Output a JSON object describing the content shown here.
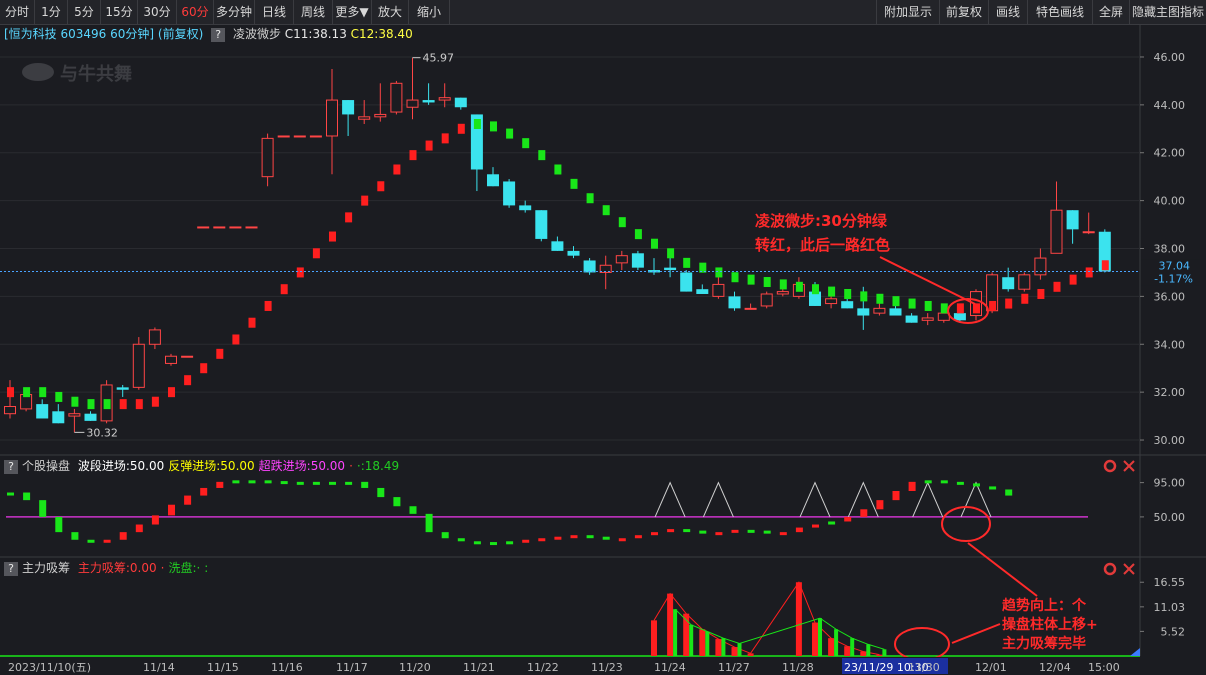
{
  "toolbar": {
    "left": [
      {
        "label": "分时",
        "active": false
      },
      {
        "label": "1分",
        "active": false
      },
      {
        "label": "5分",
        "active": false
      },
      {
        "label": "15分",
        "active": false
      },
      {
        "label": "30分",
        "active": false
      },
      {
        "label": "60分",
        "active": true
      },
      {
        "label": "多分钟",
        "active": false
      },
      {
        "label": "日线",
        "active": false
      },
      {
        "label": "周线",
        "active": false
      },
      {
        "label": "更多▼",
        "active": false
      },
      {
        "label": "放大",
        "active": false
      },
      {
        "label": "缩小",
        "active": false
      }
    ],
    "right": [
      "附加显示",
      "前复权",
      "画线",
      "特色画线",
      "全屏",
      "隐藏主图指标"
    ]
  },
  "info": {
    "stock": "[恒为科技 603496 60分钟]",
    "adjust": "(前复权)",
    "indicator": "凌波微步",
    "c1": "C11:38.13",
    "c2": "C12:38.40",
    "help": "?"
  },
  "watermark": "与牛共舞",
  "main_axis": {
    "ticks": [
      "46.00",
      "44.00",
      "42.00",
      "40.00",
      "38.00",
      "36.00",
      "34.00",
      "32.00",
      "30.00"
    ]
  },
  "price_marker": {
    "price": "37.04",
    "pct": "-1.17%"
  },
  "annotations": {
    "high_label": "45.97",
    "low_label": "30.32",
    "note1_line1": "凌波微步:30分钟绿",
    "note1_line2": "转红，此后一路红色",
    "note2_line1": "趋势向上：个",
    "note2_line2": "操盘柱体上移+",
    "note2_line3": "主力吸筹完毕"
  },
  "panel2": {
    "title": "个股操盘",
    "params": [
      {
        "text": "波段进场:50.00",
        "color": "#ffffff"
      },
      {
        "text": "反弹进场:50.00",
        "color": "#ffff00"
      },
      {
        "text": "超跌进场:50.00",
        "color": "#ff44ff"
      },
      {
        "text": "·",
        "color": "#ff3b3b"
      },
      {
        "text": "·:18.49",
        "color": "#22cc22"
      }
    ],
    "ticks": [
      "95.00",
      "50.00"
    ]
  },
  "panel3": {
    "title": "主力吸筹",
    "params": [
      {
        "text": "主力吸筹:0.00",
        "color": "#ff3b3b"
      },
      {
        "text": "·",
        "color": "#ff3b3b"
      },
      {
        "text": "洗盘:·",
        "color": "#22cc22"
      },
      {
        "text": ":",
        "color": "#22cc22"
      }
    ],
    "ticks": [
      "16.55",
      "11.03",
      "5.52"
    ]
  },
  "xaxis": {
    "labels": [
      "2023/11/10(五)",
      "11/14",
      "11/15",
      "11/16",
      "11/17",
      "11/20",
      "11/21",
      "11/22",
      "11/23",
      "11/24",
      "11/27",
      "11/28",
      "23/11/29 10:30",
      "11/30",
      "12/01",
      "12/04",
      "15:00"
    ]
  },
  "chart_data": {
    "type": "candlestick",
    "period": "60分钟",
    "ylim": [
      29.5,
      46.5
    ],
    "candles": [
      {
        "o": 31.1,
        "h": 32.5,
        "l": 30.9,
        "c": 31.4
      },
      {
        "o": 31.3,
        "h": 32.0,
        "l": 31.2,
        "c": 31.9
      },
      {
        "o": 31.5,
        "h": 31.7,
        "l": 30.9,
        "c": 30.9
      },
      {
        "o": 31.2,
        "h": 31.5,
        "l": 30.7,
        "c": 30.7
      },
      {
        "o": 31.0,
        "h": 31.3,
        "l": 30.32,
        "c": 31.1
      },
      {
        "o": 31.1,
        "h": 31.2,
        "l": 30.8,
        "c": 30.8
      },
      {
        "o": 30.8,
        "h": 32.5,
        "l": 30.7,
        "c": 32.3
      },
      {
        "o": 32.2,
        "h": 32.3,
        "l": 31.8,
        "c": 32.1
      },
      {
        "o": 32.2,
        "h": 34.3,
        "l": 32.1,
        "c": 34.0
      },
      {
        "o": 34.0,
        "h": 34.7,
        "l": 33.8,
        "c": 34.6
      },
      {
        "o": 33.2,
        "h": 33.6,
        "l": 33.1,
        "c": 33.5
      },
      {
        "o": 33.5,
        "h": 33.5,
        "l": 33.5,
        "c": 33.5
      },
      {
        "o": 38.9,
        "h": 38.9,
        "l": 38.9,
        "c": 38.9
      },
      {
        "o": 38.9,
        "h": 38.9,
        "l": 38.9,
        "c": 38.9
      },
      {
        "o": 38.9,
        "h": 38.9,
        "l": 38.9,
        "c": 38.9
      },
      {
        "o": 38.9,
        "h": 38.9,
        "l": 38.9,
        "c": 38.9
      },
      {
        "o": 41.0,
        "h": 42.8,
        "l": 40.6,
        "c": 42.6
      },
      {
        "o": 42.7,
        "h": 42.7,
        "l": 42.7,
        "c": 42.7
      },
      {
        "o": 42.7,
        "h": 42.7,
        "l": 42.7,
        "c": 42.7
      },
      {
        "o": 42.7,
        "h": 42.7,
        "l": 42.7,
        "c": 42.7
      },
      {
        "o": 42.7,
        "h": 45.5,
        "l": 41.1,
        "c": 44.2
      },
      {
        "o": 44.2,
        "h": 44.2,
        "l": 42.7,
        "c": 43.6
      },
      {
        "o": 43.4,
        "h": 44.2,
        "l": 43.2,
        "c": 43.5
      },
      {
        "o": 43.5,
        "h": 44.9,
        "l": 43.3,
        "c": 43.6
      },
      {
        "o": 43.7,
        "h": 45.0,
        "l": 43.6,
        "c": 44.9
      },
      {
        "o": 43.9,
        "h": 45.97,
        "l": 43.4,
        "c": 44.2
      },
      {
        "o": 44.2,
        "h": 44.9,
        "l": 44.0,
        "c": 44.1
      },
      {
        "o": 44.2,
        "h": 44.9,
        "l": 43.9,
        "c": 44.3
      },
      {
        "o": 44.3,
        "h": 44.3,
        "l": 43.8,
        "c": 43.9
      },
      {
        "o": 43.6,
        "h": 43.6,
        "l": 40.4,
        "c": 41.3
      },
      {
        "o": 41.1,
        "h": 41.4,
        "l": 40.6,
        "c": 40.6
      },
      {
        "o": 40.8,
        "h": 40.9,
        "l": 39.7,
        "c": 39.8
      },
      {
        "o": 39.8,
        "h": 40.0,
        "l": 39.5,
        "c": 39.6
      },
      {
        "o": 39.6,
        "h": 39.6,
        "l": 38.3,
        "c": 38.4
      },
      {
        "o": 38.3,
        "h": 38.5,
        "l": 37.9,
        "c": 37.9
      },
      {
        "o": 37.9,
        "h": 38.1,
        "l": 37.6,
        "c": 37.7
      },
      {
        "o": 37.5,
        "h": 37.6,
        "l": 36.9,
        "c": 37.0
      },
      {
        "o": 37.0,
        "h": 37.7,
        "l": 36.3,
        "c": 37.3
      },
      {
        "o": 37.4,
        "h": 37.9,
        "l": 37.1,
        "c": 37.7
      },
      {
        "o": 37.8,
        "h": 37.9,
        "l": 37.1,
        "c": 37.2
      },
      {
        "o": 37.1,
        "h": 37.6,
        "l": 36.9,
        "c": 37.0
      },
      {
        "o": 37.2,
        "h": 37.7,
        "l": 36.8,
        "c": 37.1
      },
      {
        "o": 37.0,
        "h": 37.1,
        "l": 36.2,
        "c": 36.2
      },
      {
        "o": 36.3,
        "h": 36.5,
        "l": 36.1,
        "c": 36.1
      },
      {
        "o": 36.0,
        "h": 36.8,
        "l": 35.9,
        "c": 36.5
      },
      {
        "o": 36.0,
        "h": 36.2,
        "l": 35.4,
        "c": 35.5
      },
      {
        "o": 35.5,
        "h": 35.7,
        "l": 35.5,
        "c": 35.5
      },
      {
        "o": 35.6,
        "h": 36.2,
        "l": 35.5,
        "c": 36.1
      },
      {
        "o": 36.1,
        "h": 36.5,
        "l": 36.0,
        "c": 36.2
      },
      {
        "o": 36.0,
        "h": 36.8,
        "l": 35.9,
        "c": 36.5
      },
      {
        "o": 36.2,
        "h": 36.6,
        "l": 35.6,
        "c": 35.6
      },
      {
        "o": 35.7,
        "h": 36.0,
        "l": 35.5,
        "c": 35.9
      },
      {
        "o": 35.8,
        "h": 36.0,
        "l": 35.5,
        "c": 35.5
      },
      {
        "o": 35.5,
        "h": 36.4,
        "l": 34.6,
        "c": 35.2
      },
      {
        "o": 35.3,
        "h": 35.9,
        "l": 35.2,
        "c": 35.5
      },
      {
        "o": 35.5,
        "h": 35.6,
        "l": 35.2,
        "c": 35.2
      },
      {
        "o": 35.2,
        "h": 35.3,
        "l": 34.9,
        "c": 34.9
      },
      {
        "o": 35.0,
        "h": 35.3,
        "l": 34.8,
        "c": 35.1
      },
      {
        "o": 35.0,
        "h": 35.4,
        "l": 34.9,
        "c": 35.3
      },
      {
        "o": 35.3,
        "h": 35.7,
        "l": 34.9,
        "c": 35.0
      },
      {
        "o": 35.2,
        "h": 36.3,
        "l": 35.0,
        "c": 36.2
      },
      {
        "o": 35.4,
        "h": 37.0,
        "l": 35.3,
        "c": 36.9
      },
      {
        "o": 36.8,
        "h": 37.2,
        "l": 36.2,
        "c": 36.3
      },
      {
        "o": 36.3,
        "h": 37.0,
        "l": 36.2,
        "c": 36.9
      },
      {
        "o": 36.9,
        "h": 38.0,
        "l": 36.7,
        "c": 37.6
      },
      {
        "o": 37.8,
        "h": 40.8,
        "l": 37.8,
        "c": 39.6
      },
      {
        "o": 39.6,
        "h": 39.6,
        "l": 38.2,
        "c": 38.8
      },
      {
        "o": 38.7,
        "h": 39.5,
        "l": 38.6,
        "c": 38.7
      },
      {
        "o": 38.7,
        "h": 38.8,
        "l": 37.0,
        "c": 37.04
      }
    ],
    "ling_bo_wei_bu": [
      {
        "v": 32.0,
        "color": "red"
      },
      {
        "v": 32.0,
        "color": "green"
      },
      {
        "v": 32.0,
        "color": "green"
      },
      {
        "v": 31.8,
        "color": "green"
      },
      {
        "v": 31.6,
        "color": "green"
      },
      {
        "v": 31.5,
        "color": "green"
      },
      {
        "v": 31.5,
        "color": "green"
      },
      {
        "v": 31.5,
        "color": "red"
      },
      {
        "v": 31.5,
        "color": "red"
      },
      {
        "v": 31.6,
        "color": "red"
      },
      {
        "v": 32.0,
        "color": "red"
      },
      {
        "v": 32.5,
        "color": "red"
      },
      {
        "v": 33.0,
        "color": "red"
      },
      {
        "v": 33.6,
        "color": "red"
      },
      {
        "v": 34.2,
        "color": "red"
      },
      {
        "v": 34.9,
        "color": "red"
      },
      {
        "v": 35.6,
        "color": "red"
      },
      {
        "v": 36.3,
        "color": "red"
      },
      {
        "v": 37.0,
        "color": "red"
      },
      {
        "v": 37.8,
        "color": "red"
      },
      {
        "v": 38.5,
        "color": "red"
      },
      {
        "v": 39.3,
        "color": "red"
      },
      {
        "v": 40.0,
        "color": "red"
      },
      {
        "v": 40.6,
        "color": "red"
      },
      {
        "v": 41.3,
        "color": "red"
      },
      {
        "v": 41.9,
        "color": "red"
      },
      {
        "v": 42.3,
        "color": "red"
      },
      {
        "v": 42.6,
        "color": "red"
      },
      {
        "v": 43.0,
        "color": "red"
      },
      {
        "v": 43.2,
        "color": "green"
      },
      {
        "v": 43.1,
        "color": "green"
      },
      {
        "v": 42.8,
        "color": "green"
      },
      {
        "v": 42.4,
        "color": "green"
      },
      {
        "v": 41.9,
        "color": "green"
      },
      {
        "v": 41.3,
        "color": "green"
      },
      {
        "v": 40.7,
        "color": "green"
      },
      {
        "v": 40.1,
        "color": "green"
      },
      {
        "v": 39.6,
        "color": "green"
      },
      {
        "v": 39.1,
        "color": "green"
      },
      {
        "v": 38.6,
        "color": "green"
      },
      {
        "v": 38.2,
        "color": "green"
      },
      {
        "v": 37.8,
        "color": "green"
      },
      {
        "v": 37.4,
        "color": "green"
      },
      {
        "v": 37.2,
        "color": "green"
      },
      {
        "v": 37.0,
        "color": "green"
      },
      {
        "v": 36.8,
        "color": "green"
      },
      {
        "v": 36.7,
        "color": "green"
      },
      {
        "v": 36.6,
        "color": "green"
      },
      {
        "v": 36.5,
        "color": "green"
      },
      {
        "v": 36.4,
        "color": "green"
      },
      {
        "v": 36.3,
        "color": "green"
      },
      {
        "v": 36.2,
        "color": "green"
      },
      {
        "v": 36.1,
        "color": "green"
      },
      {
        "v": 36.0,
        "color": "green"
      },
      {
        "v": 35.9,
        "color": "green"
      },
      {
        "v": 35.8,
        "color": "green"
      },
      {
        "v": 35.7,
        "color": "green"
      },
      {
        "v": 35.6,
        "color": "green"
      },
      {
        "v": 35.5,
        "color": "green"
      },
      {
        "v": 35.5,
        "color": "red"
      },
      {
        "v": 35.5,
        "color": "red"
      },
      {
        "v": 35.6,
        "color": "red"
      },
      {
        "v": 35.7,
        "color": "red"
      },
      {
        "v": 35.9,
        "color": "red"
      },
      {
        "v": 36.1,
        "color": "red"
      },
      {
        "v": 36.4,
        "color": "red"
      },
      {
        "v": 36.7,
        "color": "red"
      },
      {
        "v": 37.0,
        "color": "red"
      },
      {
        "v": 37.3,
        "color": "red"
      }
    ],
    "ge_gu_cao_pan": [
      {
        "v": 82,
        "color": "green"
      },
      {
        "v": 72,
        "color": "green"
      },
      {
        "v": 50,
        "color": "green"
      },
      {
        "v": 30,
        "color": "green"
      },
      {
        "v": 20,
        "color": "green"
      },
      {
        "v": 18,
        "color": "green"
      },
      {
        "v": 20,
        "color": "red"
      },
      {
        "v": 30,
        "color": "red"
      },
      {
        "v": 40,
        "color": "red"
      },
      {
        "v": 52,
        "color": "red"
      },
      {
        "v": 66,
        "color": "red"
      },
      {
        "v": 78,
        "color": "red"
      },
      {
        "v": 88,
        "color": "red"
      },
      {
        "v": 96,
        "color": "red"
      },
      {
        "v": 98,
        "color": "green"
      },
      {
        "v": 98,
        "color": "green"
      },
      {
        "v": 97,
        "color": "green"
      },
      {
        "v": 96,
        "color": "green"
      },
      {
        "v": 96,
        "color": "green"
      },
      {
        "v": 96,
        "color": "green"
      },
      {
        "v": 96,
        "color": "green"
      },
      {
        "v": 96,
        "color": "green"
      },
      {
        "v": 88,
        "color": "green"
      },
      {
        "v": 76,
        "color": "green"
      },
      {
        "v": 64,
        "color": "green"
      },
      {
        "v": 54,
        "color": "green"
      },
      {
        "v": 30,
        "color": "green"
      },
      {
        "v": 22,
        "color": "green"
      },
      {
        "v": 18,
        "color": "green"
      },
      {
        "v": 17,
        "color": "green"
      },
      {
        "v": 17,
        "color": "green"
      },
      {
        "v": 18,
        "color": "green"
      },
      {
        "v": 20,
        "color": "red"
      },
      {
        "v": 22,
        "color": "red"
      },
      {
        "v": 24,
        "color": "red"
      },
      {
        "v": 26,
        "color": "red"
      },
      {
        "v": 24,
        "color": "green"
      },
      {
        "v": 22,
        "color": "green"
      },
      {
        "v": 22,
        "color": "red"
      },
      {
        "v": 26,
        "color": "red"
      },
      {
        "v": 30,
        "color": "red"
      },
      {
        "v": 34,
        "color": "red"
      },
      {
        "v": 32,
        "color": "green"
      },
      {
        "v": 30,
        "color": "green"
      },
      {
        "v": 30,
        "color": "red"
      },
      {
        "v": 33,
        "color": "red"
      },
      {
        "v": 32,
        "color": "green"
      },
      {
        "v": 30,
        "color": "green"
      },
      {
        "v": 30,
        "color": "red"
      },
      {
        "v": 36,
        "color": "red"
      },
      {
        "v": 40,
        "color": "red"
      },
      {
        "v": 44,
        "color": "green"
      },
      {
        "v": 50,
        "color": "red"
      },
      {
        "v": 60,
        "color": "red"
      },
      {
        "v": 72,
        "color": "red"
      },
      {
        "v": 84,
        "color": "red"
      },
      {
        "v": 96,
        "color": "red"
      },
      {
        "v": 98,
        "color": "green"
      },
      {
        "v": 96,
        "color": "green"
      },
      {
        "v": 94,
        "color": "green"
      },
      {
        "v": 90,
        "color": "green"
      },
      {
        "v": 86,
        "color": "green"
      },
      {
        "v": 78,
        "color": "green"
      }
    ],
    "triangles_at": [
      41,
      44,
      50,
      53,
      57,
      60
    ],
    "zhu_li_xi_chou": [
      {
        "i": 40,
        "v": 8.0
      },
      {
        "i": 41,
        "v": 14.0
      },
      {
        "i": 42,
        "v": 9.5
      },
      {
        "i": 43,
        "v": 6.0
      },
      {
        "i": 44,
        "v": 3.8
      },
      {
        "i": 45,
        "v": 2.0
      },
      {
        "i": 46,
        "v": 0.6
      },
      {
        "i": 49,
        "v": 16.55
      },
      {
        "i": 50,
        "v": 7.5
      },
      {
        "i": 51,
        "v": 4.0
      },
      {
        "i": 52,
        "v": 2.2
      },
      {
        "i": 53,
        "v": 1.0
      },
      {
        "i": 54,
        "v": 0.3
      }
    ],
    "zhu_li_green": [
      {
        "i": 41,
        "v": 10.5
      },
      {
        "i": 42,
        "v": 7.0
      },
      {
        "i": 43,
        "v": 5.5
      },
      {
        "i": 44,
        "v": 4.0
      },
      {
        "i": 45,
        "v": 2.8
      },
      {
        "i": 50,
        "v": 8.5
      },
      {
        "i": 51,
        "v": 6.0
      },
      {
        "i": 52,
        "v": 4.0
      },
      {
        "i": 53,
        "v": 2.6
      },
      {
        "i": 54,
        "v": 1.5
      }
    ],
    "panel3_ylim": [
      0,
      17.5
    ]
  }
}
